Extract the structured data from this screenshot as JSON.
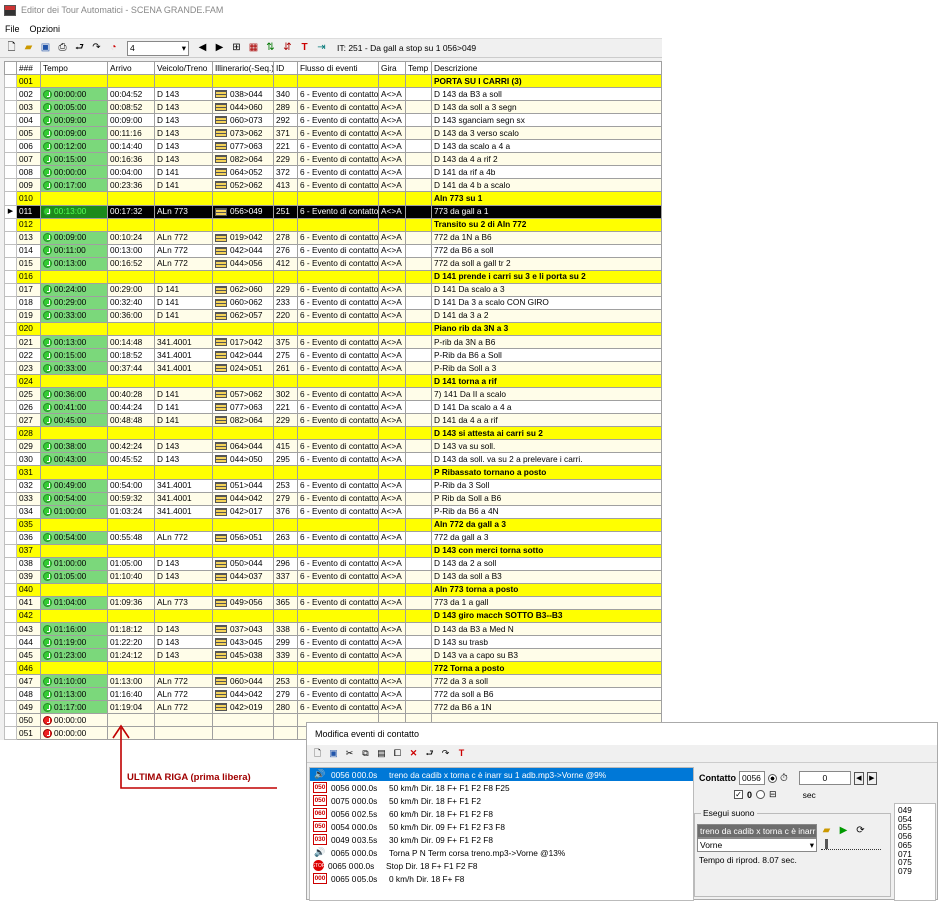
{
  "title": "Editor dei Tour Automatici - SCENA GRANDE.FAM",
  "menu": [
    "File",
    "Opzioni"
  ],
  "toolbar": {
    "combo_value": "4",
    "status": "IT: 251 - Da gall a stop su  1 056>049"
  },
  "columns": [
    "###",
    "Tempo",
    "Arrivo",
    "Veicolo/Treno",
    "Illinerario(-Seq.)",
    "ID",
    "Flusso di eventi",
    "Gira",
    "Temp",
    "Descrizione"
  ],
  "rows": [
    {
      "n": "001",
      "k": "h",
      "desc": "PORTA SU I CARRI (3)"
    },
    {
      "n": "002",
      "t": "00:00:00",
      "a": "00:04:52",
      "v": "D 143",
      "it": "038>044",
      "id": "340",
      "f": "6 - Evento di contatto",
      "g": "A<>A",
      "d": "D 143 da B3 a soll"
    },
    {
      "n": "003",
      "t": "00:05:00",
      "a": "00:08:52",
      "v": "D 143",
      "it": "044>060",
      "id": "289",
      "f": "6 - Evento di contatto",
      "g": "A<>A",
      "d": "D 143 da soll a 3 segn"
    },
    {
      "n": "004",
      "t": "00:09:00",
      "a": "00:09:00",
      "v": "D 143",
      "it": "060>073",
      "id": "292",
      "f": "6 - Evento di contatto",
      "g": "A<>A",
      "d": "D 143 sganciam segn sx"
    },
    {
      "n": "005",
      "t": "00:09:00",
      "a": "00:11:16",
      "v": "D 143",
      "it": "073>062",
      "id": "371",
      "f": "6 - Evento di contatto",
      "g": "A<>A",
      "d": "D 143 da 3 verso scalo"
    },
    {
      "n": "006",
      "t": "00:12:00",
      "a": "00:14:40",
      "v": "D 143",
      "it": "077>063",
      "id": "221",
      "f": "6 - Evento di contatto",
      "g": "A<>A",
      "d": "D 143 da scalo a 4 a"
    },
    {
      "n": "007",
      "t": "00:15:00",
      "a": "00:16:36",
      "v": "D 143",
      "it": "082>064",
      "id": "229",
      "f": "6 - Evento di contatto",
      "g": "A<>A",
      "d": "D 143 da 4 a rif 2"
    },
    {
      "n": "008",
      "t": "00:00:00",
      "a": "00:04:00",
      "v": "D 141",
      "it": "064>052",
      "id": "372",
      "f": "6 - Evento di contatto",
      "g": "A<>A",
      "d": "D 141 da rif a 4b"
    },
    {
      "n": "009",
      "t": "00:17:00",
      "a": "00:23:36",
      "v": "D 141",
      "it": "052>062",
      "id": "413",
      "f": "6 - Evento di contatto",
      "g": "A<>A",
      "d": "D 141 da 4 b a scalo"
    },
    {
      "n": "010",
      "k": "h",
      "desc": "Aln 773 su 1"
    },
    {
      "n": "011",
      "k": "cur",
      "t": "00:13:00",
      "a": "00:17:32",
      "v": "ALn 773",
      "it": "056>049",
      "id": "251",
      "f": "6 - Evento di contatto",
      "g": "A<>A",
      "d": "773 da gall a 1"
    },
    {
      "n": "012",
      "k": "h",
      "desc": "Transito su 2 di Aln 772"
    },
    {
      "n": "013",
      "t": "00:09:00",
      "a": "00:10:24",
      "v": "ALn 772",
      "it": "019>042",
      "id": "278",
      "f": "6 - Evento di contatto",
      "g": "A<>A",
      "d": "772 da 1N a B6"
    },
    {
      "n": "014",
      "t": "00:11:00",
      "a": "00:13:00",
      "v": "ALn 772",
      "it": "042>044",
      "id": "276",
      "f": "6 - Evento di contatto",
      "g": "A<>A",
      "d": "772 da B6 a soll"
    },
    {
      "n": "015",
      "t": "00:13:00",
      "a": "00:16:52",
      "v": "ALn 772",
      "it": "044>056",
      "id": "412",
      "f": "6 - Evento di contatto",
      "g": "A<>A",
      "d": "772 da soll a gall tr 2"
    },
    {
      "n": "016",
      "k": "h",
      "desc": "D 141 prende i carri su 3 e li porta su 2"
    },
    {
      "n": "017",
      "t": "00:24:00",
      "a": "00:29:00",
      "v": "D 141",
      "it": "062>060",
      "id": "229",
      "f": "6 - Evento di contatto",
      "g": "A<>A",
      "d": "D 141 Da scalo a 3"
    },
    {
      "n": "018",
      "t": "00:29:00",
      "a": "00:32:40",
      "v": "D 141",
      "it": "060>062",
      "id": "233",
      "f": "6 - Evento di contatto",
      "g": "A<>A",
      "d": "D 141 Da 3 a scalo CON GIRO"
    },
    {
      "n": "019",
      "t": "00:33:00",
      "a": "00:36:00",
      "v": "D 141",
      "it": "062>057",
      "id": "220",
      "f": "6 - Evento di contatto",
      "g": "A<>A",
      "d": "D 141 da 3 a 2"
    },
    {
      "n": "020",
      "k": "h",
      "desc": "Piano rib da 3N a 3"
    },
    {
      "n": "021",
      "t": "00:13:00",
      "a": "00:14:48",
      "v": "341.4001",
      "it": "017>042",
      "id": "375",
      "f": "6 - Evento di contatto",
      "g": "A<>A",
      "d": "P-rib da 3N a B6"
    },
    {
      "n": "022",
      "t": "00:15:00",
      "a": "00:18:52",
      "v": "341.4001",
      "it": "042>044",
      "id": "275",
      "f": "6 - Evento di contatto",
      "g": "A<>A",
      "d": "P-Rib da B6 a Soll"
    },
    {
      "n": "023",
      "t": "00:33:00",
      "a": "00:37:44",
      "v": "341.4001",
      "it": "024>051",
      "id": "261",
      "f": "6 - Evento di contatto",
      "g": "A<>A",
      "d": "P-Rib da Soll a 3"
    },
    {
      "n": "024",
      "k": "h",
      "desc": "D 141 torna a rif"
    },
    {
      "n": "025",
      "t": "00:36:00",
      "a": "00:40:28",
      "v": "D 141",
      "it": "057>062",
      "id": "302",
      "f": "6 - Evento di contatto",
      "g": "A<>A",
      "d": "7) 141 Da II a scalo"
    },
    {
      "n": "026",
      "t": "00:41:00",
      "a": "00:44:24",
      "v": "D 141",
      "it": "077>063",
      "id": "221",
      "f": "6 - Evento di contatto",
      "g": "A<>A",
      "d": " D 141 Da scalo  a 4 a"
    },
    {
      "n": "027",
      "t": "00:45:00",
      "a": "00:48:48",
      "v": "D 141",
      "it": "082>064",
      "id": "229",
      "f": "6 - Evento di contatto",
      "g": "A<>A",
      "d": "D 141 da 4 a a rif"
    },
    {
      "n": "028",
      "k": "h",
      "desc": "D 143 si attesta ai carri su 2"
    },
    {
      "n": "029",
      "t": "00:38:00",
      "a": "00:42:24",
      "v": "D 143",
      "it": "064>044",
      "id": "415",
      "f": "6 - Evento di contatto",
      "g": "A<>A",
      "d": "D 143 va su soll."
    },
    {
      "n": "030",
      "t": "00:43:00",
      "a": "00:45:52",
      "v": "D 143",
      "it": "044>050",
      "id": "295",
      "f": "6 - Evento di contatto",
      "g": "A<>A",
      "d": "D 143 da soll. va su 2 a prelevare i carri."
    },
    {
      "n": "031",
      "k": "h",
      "desc": "P Ribassato tornano a posto"
    },
    {
      "n": "032",
      "t": "00:49:00",
      "a": "00:54:00",
      "v": "341.4001",
      "it": "051>044",
      "id": "253",
      "f": "6 - Evento di contatto",
      "g": "A<>A",
      "d": "P-Rib da 3 Soll"
    },
    {
      "n": "033",
      "t": "00:54:00",
      "a": "00:59:32",
      "v": "341.4001",
      "it": "044>042",
      "id": "279",
      "f": "6 - Evento di contatto",
      "g": "A<>A",
      "d": "P Rib da Soll a B6"
    },
    {
      "n": "034",
      "t": "01:00:00",
      "a": "01:03:24",
      "v": "341.4001",
      "it": "042>017",
      "id": "376",
      "f": "6 - Evento di contatto",
      "g": "A<>A",
      "d": "P-Rib da B6 a 4N"
    },
    {
      "n": "035",
      "k": "h",
      "desc": "Aln 772 da gall a 3"
    },
    {
      "n": "036",
      "t": "00:54:00",
      "a": "00:55:48",
      "v": "ALn 772",
      "it": "056>051",
      "id": "263",
      "f": "6 - Evento di contatto",
      "g": "A<>A",
      "d": "772 da gall a 3"
    },
    {
      "n": "037",
      "k": "h",
      "desc": "D 143 con merci torna sotto"
    },
    {
      "n": "038",
      "t": "01:00:00",
      "a": "01:05:00",
      "v": "D 143",
      "it": "050>044",
      "id": "296",
      "f": "6 - Evento di contatto",
      "g": "A<>A",
      "d": "D 143 da 2 a soll"
    },
    {
      "n": "039",
      "t": "01:05:00",
      "a": "01:10:40",
      "v": "D 143",
      "it": "044>037",
      "id": "337",
      "f": "6 - Evento di contatto",
      "g": "A<>A",
      "d": "D 143 da soll a B3"
    },
    {
      "n": "040",
      "k": "h",
      "desc": "Aln 773 torna a posto"
    },
    {
      "n": "041",
      "t": "01:04:00",
      "a": "01:09:36",
      "v": "ALn 773",
      "it": "049>056",
      "id": "365",
      "f": "6 - Evento di contatto",
      "g": "A<>A",
      "d": "773 da 1 a gall"
    },
    {
      "n": "042",
      "k": "h",
      "desc": "D 143 giro macch SOTTO B3--B3"
    },
    {
      "n": "043",
      "t": "01:16:00",
      "a": "01:18:12",
      "v": "D 143",
      "it": "037>043",
      "id": "338",
      "f": "6 - Evento di contatto",
      "g": "A<>A",
      "d": "D 143 da B3 a Med N"
    },
    {
      "n": "044",
      "t": "01:19:00",
      "a": "01:22:20",
      "v": "D 143",
      "it": "043>045",
      "id": "299",
      "f": "6 - Evento di contatto",
      "g": "A<>A",
      "d": "D 143 su trasb"
    },
    {
      "n": "045",
      "t": "01:23:00",
      "a": "01:24:12",
      "v": "D 143",
      "it": "045>038",
      "id": "339",
      "f": "6 - Evento di contatto",
      "g": "A<>A",
      "d": "D 143 va a capo su B3"
    },
    {
      "n": "046",
      "k": "h",
      "desc": "772 Torna a posto"
    },
    {
      "n": "047",
      "t": "01:10:00",
      "a": "01:13:00",
      "v": "ALn 772",
      "it": "060>044",
      "id": "253",
      "f": "6 - Evento di contatto",
      "g": "A<>A",
      "d": "772 da 3 a soll"
    },
    {
      "n": "048",
      "t": "01:13:00",
      "a": "01:16:40",
      "v": "ALn 772",
      "it": "044>042",
      "id": "279",
      "f": "6 - Evento di contatto",
      "g": "A<>A",
      "d": "772 da soll a B6"
    },
    {
      "n": "049",
      "t": "01:17:00",
      "a": "01:19:04",
      "v": "ALn 772",
      "it": "042>019",
      "id": "280",
      "f": "6 - Evento di contatto",
      "g": "A<>A",
      "d": "772 da B6 a 1N"
    },
    {
      "n": "050",
      "k": "e",
      "t": "00:00:00"
    },
    {
      "n": "051",
      "k": "e",
      "t": "00:00:00"
    }
  ],
  "annotation": "ULTIMA RIGA (prima libera)",
  "dialog": {
    "title": "Modifica eventi di contatto",
    "events": [
      {
        "icon": "sound",
        "c1": "0056 0",
        "c2": "00.0s",
        "text": "treno da cadib x torna c è inarr su 1 adb.mp3->Vorne @9%",
        "sel": true
      },
      {
        "icon": "speed",
        "iv": "050",
        "c1": "0056 0",
        "c2": "00.0s",
        "text": "50 km/h Dir. 18 F+ F1 F2 F8 F25"
      },
      {
        "icon": "speed",
        "iv": "050",
        "c1": "0075 0",
        "c2": "00.0s",
        "text": "50 km/h Dir. 18 F+ F1 F2"
      },
      {
        "icon": "speed",
        "iv": "060",
        "c1": "0056 0",
        "c2": "02.5s",
        "text": "60 km/h Dir. 18 F+ F1 F2 F8"
      },
      {
        "icon": "speed",
        "iv": "050",
        "c1": "0054 0",
        "c2": "00.0s",
        "text": "50 km/h Dir. 09 F+ F1 F2 F3 F8"
      },
      {
        "icon": "speed",
        "iv": "030",
        "c1": "0049 0",
        "c2": "03.5s",
        "text": "30 km/h Dir. 09 F+ F1 F2 F8"
      },
      {
        "icon": "sound",
        "c1": "0065 0",
        "c2": "00.0s",
        "text": "Torna P N Term corsa treno.mp3->Vorne @13%"
      },
      {
        "icon": "stop",
        "iv": "STOP",
        "c1": "0065 0",
        "c2": "00.0s",
        "text": "Stop Dir. 18 F+ F1 F2 F8"
      },
      {
        "icon": "speed",
        "iv": "000",
        "c1": "0065 0",
        "c2": "05.0s",
        "text": "0 km/h Dir. 18 F+ F8"
      }
    ],
    "contatto_label": "Contatto",
    "contatto_value": "0056",
    "delay_value": "0",
    "check_value": "0",
    "sec_label": "sec",
    "group_label": "Esegui suono",
    "sound_file": "treno da cadib x torna c è inarr su",
    "speaker": "Vorne",
    "play_time": "Tempo di riprod. 8.07 sec.",
    "contacts_list": [
      "049",
      "054",
      "055",
      "056",
      "065",
      "071",
      "075",
      "079"
    ]
  }
}
